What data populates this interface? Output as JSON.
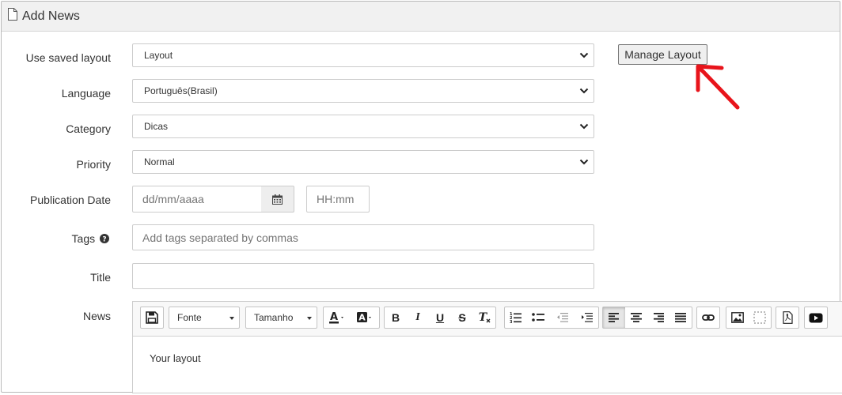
{
  "header": {
    "title": "Add News",
    "icon": "file-icon"
  },
  "form": {
    "layout": {
      "label": "Use saved layout",
      "value": "Layout"
    },
    "manage_button": "Manage Layout",
    "language": {
      "label": "Language",
      "value": "Português(Brasil)"
    },
    "category": {
      "label": "Category",
      "value": "Dicas"
    },
    "priority": {
      "label": "Priority",
      "value": "Normal"
    },
    "publication": {
      "label": "Publication Date",
      "date_placeholder": "dd/mm/aaaa",
      "time_placeholder": "HH:mm"
    },
    "tags": {
      "label": "Tags",
      "placeholder": "Add tags separated by commas"
    },
    "title": {
      "label": "Title",
      "value": ""
    },
    "news": {
      "label": "News"
    }
  },
  "editor": {
    "font_label": "Fonte",
    "size_label": "Tamanho",
    "content": "Your layout"
  },
  "annotation": {
    "arrow_color": "#e8141b"
  }
}
